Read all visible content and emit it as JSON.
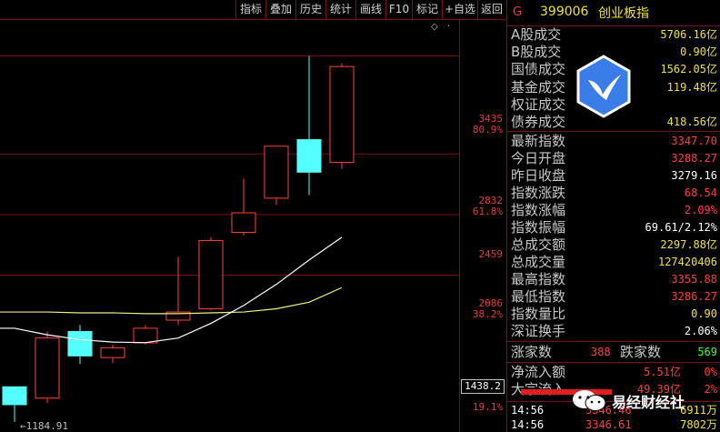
{
  "toolbar": {
    "buttons": [
      "指标",
      "叠加",
      "历史",
      "统计",
      "画线",
      "F10",
      "标记",
      "+自选",
      "返回"
    ]
  },
  "header": {
    "prefix": "G",
    "code": "399006",
    "name": "创业板指"
  },
  "trade_volume": [
    {
      "label": "A股成交",
      "value": "5706.16亿"
    },
    {
      "label": "B股成交",
      "value": "0.90亿"
    },
    {
      "label": "国债成交",
      "value": "1562.05亿"
    },
    {
      "label": "基金成交",
      "value": "119.48亿"
    },
    {
      "label": "权证成交",
      "value": ""
    },
    {
      "label": "债券成交",
      "value": "418.56亿"
    }
  ],
  "stats": [
    {
      "label": "最新指数",
      "value": "3347.70",
      "color": "#ff4040"
    },
    {
      "label": "今日开盘",
      "value": "3288.27",
      "color": "#ff4040"
    },
    {
      "label": "昨日收盘",
      "value": "3279.16",
      "color": "#ffffff"
    },
    {
      "label": "指数涨跌",
      "value": "68.54",
      "color": "#ff4040"
    },
    {
      "label": "指数涨幅",
      "value": "2.09%",
      "color": "#ff4040"
    },
    {
      "label": "指数振幅",
      "value": "69.61/2.12%",
      "color": "#ffffff"
    },
    {
      "label": "总成交额",
      "value": "2297.88亿",
      "color": "#f0e040"
    },
    {
      "label": "总成交量",
      "value": "127420406",
      "color": "#f0e040"
    },
    {
      "label": "最高指数",
      "value": "3355.88",
      "color": "#ff4040"
    },
    {
      "label": "最低指数",
      "value": "3286.27",
      "color": "#ff4040"
    },
    {
      "label": "指数量比",
      "value": "0.90",
      "color": "#f0e040"
    },
    {
      "label": "深证换手",
      "value": "2.06%",
      "color": "#ffffff"
    }
  ],
  "advance_decline": {
    "up_label": "涨家数",
    "up_value": "388",
    "down_label": "跌家数",
    "down_value": "569"
  },
  "flows": [
    {
      "label": "净流入额",
      "value": "5.51亿",
      "pct": "0%"
    },
    {
      "label": "大宗流入",
      "value": "49.39亿",
      "pct": "2%"
    }
  ],
  "ticks": [
    {
      "time": "14:56",
      "price": "3346.46",
      "vol": "6911万"
    },
    {
      "time": "14:56",
      "price": "3346.61",
      "vol": "7802万"
    }
  ],
  "watermark": {
    "text": "易经财经社"
  },
  "price_axis": {
    "labels": [
      {
        "price": "3435",
        "pct": "80.9%"
      },
      {
        "price": "2832",
        "pct": "61.8%"
      },
      {
        "price": "2459",
        "pct": ""
      },
      {
        "price": "2086",
        "pct": "38.2%"
      },
      {
        "price": "",
        "pct": "19.1%"
      }
    ],
    "current": "1438.2",
    "low_marker": "1184.91"
  },
  "colors": {
    "up": "#ff4040",
    "down": "#54ffff",
    "ma": "#f0f080",
    "ma2": "#ffffff",
    "grid": "#7a1010"
  },
  "chart_data": {
    "type": "candlestick",
    "ylim": [
      1150,
      3600
    ],
    "candles": [
      {
        "o": 1290,
        "h": 1340,
        "l": 1184.91,
        "c": 1400,
        "dir": "down"
      },
      {
        "o": 1330,
        "h": 1740,
        "l": 1300,
        "c": 1700,
        "dir": "up"
      },
      {
        "o": 1740,
        "h": 1780,
        "l": 1540,
        "c": 1590,
        "dir": "down"
      },
      {
        "o": 1580,
        "h": 1660,
        "l": 1545,
        "c": 1640,
        "dir": "up"
      },
      {
        "o": 1670,
        "h": 1780,
        "l": 1660,
        "c": 1760,
        "dir": "up"
      },
      {
        "o": 1810,
        "h": 2200,
        "l": 1780,
        "c": 1860,
        "dir": "up"
      },
      {
        "o": 1880,
        "h": 2320,
        "l": 1870,
        "c": 2300,
        "dir": "up"
      },
      {
        "o": 2350,
        "h": 2680,
        "l": 2330,
        "c": 2470,
        "dir": "up"
      },
      {
        "o": 2560,
        "h": 2780,
        "l": 2520,
        "c": 2880,
        "dir": "up"
      },
      {
        "o": 2920,
        "h": 3435,
        "l": 2580,
        "c": 2720,
        "dir": "down"
      },
      {
        "o": 2780,
        "h": 3390,
        "l": 2740,
        "c": 3370,
        "dir": "up"
      }
    ],
    "ma_fast": [
      1760,
      1720,
      1690,
      1675,
      1672,
      1700,
      1790,
      1900,
      2030,
      2180,
      2320
    ],
    "ma_slow": [
      1860,
      1860,
      1855,
      1855,
      1850,
      1850,
      1855,
      1860,
      1880,
      1920,
      2010
    ]
  }
}
